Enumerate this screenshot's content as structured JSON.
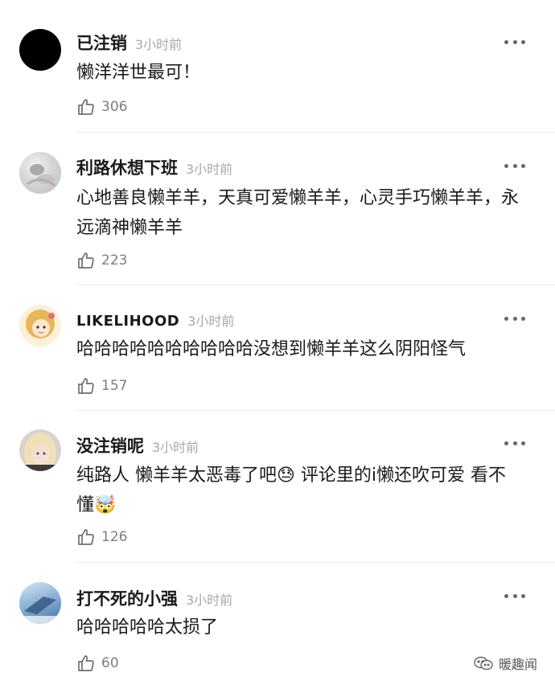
{
  "comments": [
    {
      "username": "已注销",
      "time": "3小时前",
      "text": "懒洋洋世最可！",
      "likes": "306",
      "avatar": "black-circle-avatar"
    },
    {
      "username": "利路休想下班",
      "time": "3小时前",
      "text": "心地善良懒羊羊，天真可爱懒羊羊，心灵手巧懒羊羊，永远滴神懒羊羊",
      "likes": "223",
      "avatar": "grey-photo-avatar"
    },
    {
      "username": "LIKELIHOOD",
      "time": "3小时前",
      "text": "哈哈哈哈哈哈哈哈哈哈没想到懒羊羊这么阴阳怪气",
      "likes": "157",
      "avatar": "cartoon-girl-avatar"
    },
    {
      "username": "没注销呢",
      "time": "3小时前",
      "text": "纯路人 懒羊羊太恶毒了吧😓 评论里的i懒还吹可爱 看不懂🤯",
      "likes": "126",
      "avatar": "blonde-photo-avatar"
    },
    {
      "username": "打不死的小强",
      "time": "3小时前",
      "text": "哈哈哈哈哈太损了",
      "likes": "60",
      "avatar": "blue-sky-avatar"
    }
  ],
  "watermark": {
    "text": "暖趣闻",
    "icon": "wechat-channel-icon"
  },
  "icons": {
    "like": "thumbs-up-icon",
    "more": "more-options-icon"
  }
}
